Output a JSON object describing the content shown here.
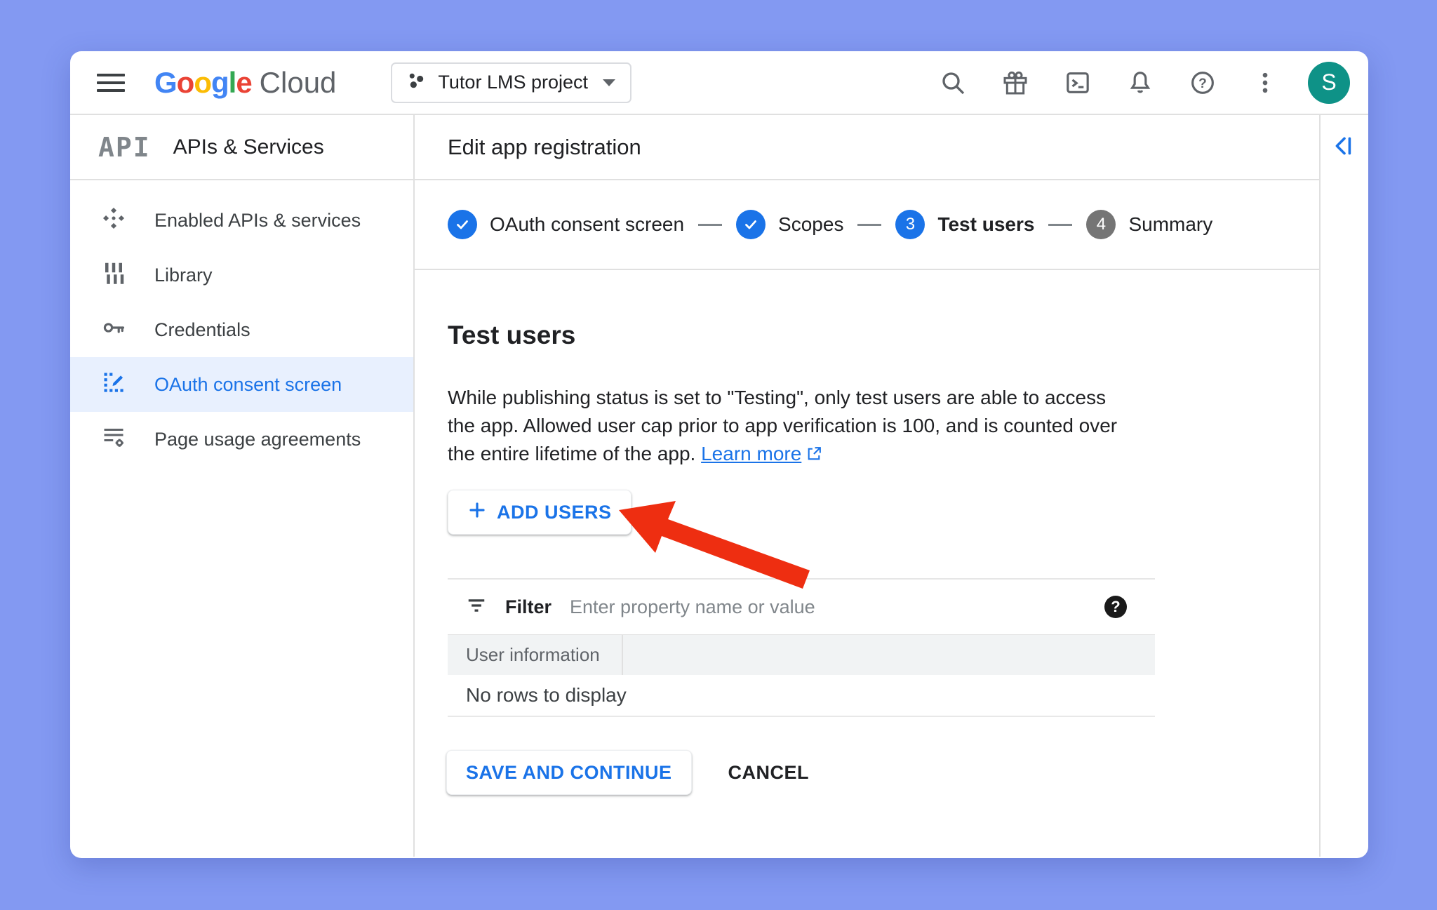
{
  "colors": {
    "page_background": "#8399f2",
    "accent_blue": "#1a73e8",
    "selected_item_bg": "#e8f0fe",
    "step_upcoming_gray": "#757575",
    "avatar_teal": "#0e9287",
    "annotation_arrow_red": "#ee2e11",
    "table_header_bg": "#f1f3f4",
    "google_logo": {
      "blue": "#4285F4",
      "red": "#EA4335",
      "yellow": "#FBBC05",
      "green": "#34A853",
      "cloud_gray": "#5f6368"
    }
  },
  "topbar": {
    "logo_letters": [
      {
        "ch": "G",
        "color": "#4285F4"
      },
      {
        "ch": "o",
        "color": "#EA4335"
      },
      {
        "ch": "o",
        "color": "#FBBC05"
      },
      {
        "ch": "g",
        "color": "#4285F4"
      },
      {
        "ch": "l",
        "color": "#34A853"
      },
      {
        "ch": "e",
        "color": "#EA4335"
      }
    ],
    "logo_suffix": "Cloud",
    "project_name": "Tutor LMS project",
    "avatar_initial": "S"
  },
  "sidebar": {
    "logo_text": "API",
    "title": "APIs & Services",
    "items": [
      {
        "label": "Enabled APIs & services",
        "selected": false
      },
      {
        "label": "Library",
        "selected": false
      },
      {
        "label": "Credentials",
        "selected": false
      },
      {
        "label": "OAuth consent screen",
        "selected": true
      },
      {
        "label": "Page usage agreements",
        "selected": false
      }
    ]
  },
  "main": {
    "header_title": "Edit app registration",
    "stepper": {
      "steps": [
        {
          "label": "OAuth consent screen",
          "state": "complete"
        },
        {
          "label": "Scopes",
          "state": "complete"
        },
        {
          "label": "Test users",
          "state": "active",
          "number": "3"
        },
        {
          "label": "Summary",
          "state": "upcoming",
          "number": "4"
        }
      ]
    },
    "section": {
      "heading": "Test users",
      "description_line1": "While publishing status is set to \"Testing\", only test users are able to access",
      "description_line2": "the app. Allowed user cap prior to app verification is 100, and is counted over",
      "description_line3": "the entire lifetime of the app.",
      "learn_more_label": "Learn more",
      "add_users_label": "ADD USERS",
      "filter_label": "Filter",
      "filter_placeholder": "Enter property name or value",
      "table_column": "User information",
      "table_empty": "No rows to display",
      "save_label": "SAVE AND CONTINUE",
      "cancel_label": "CANCEL"
    }
  }
}
